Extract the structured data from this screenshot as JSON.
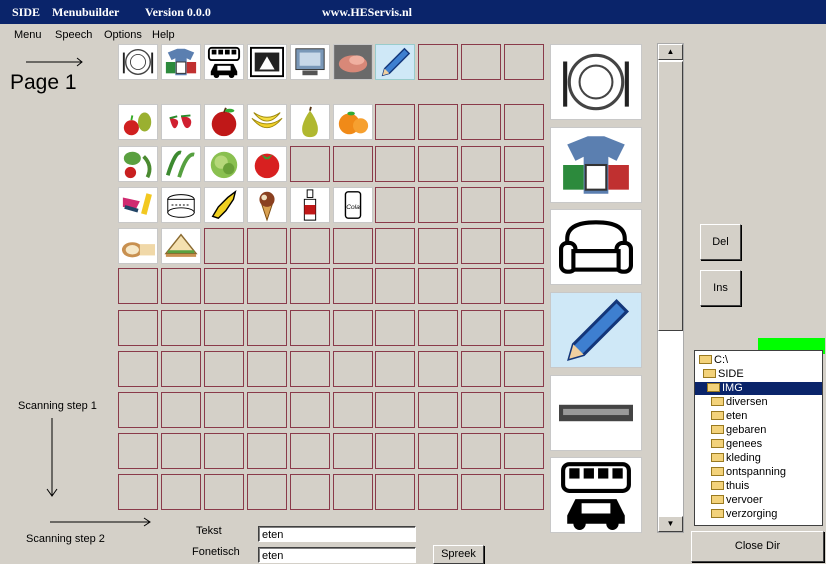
{
  "title": {
    "app": "SIDE",
    "name": "Menubuilder",
    "version": "Version 0.0.0",
    "website": "www.HEServis.nl"
  },
  "menu": [
    "Menu",
    "Speech",
    "Options",
    "Help"
  ],
  "page_label": "Page 1",
  "scan_step_1": "Scanning step 1",
  "scan_step_2": "Scanning step 2",
  "grid_rows": [
    [
      "plate-icon",
      "clothes-icon",
      "bus-car-icon",
      "laundry-icon",
      "computer-icon",
      "flesh-icon",
      "pencil-icon",
      "",
      "",
      ""
    ],
    [
      "apple-pear-icon",
      "strawberry-icon",
      "apple-icon",
      "banana-icon",
      "pear-icon",
      "orange-icon",
      "",
      "",
      "",
      ""
    ],
    [
      "vegetables-icon",
      "beans-icon",
      "lettuce-icon",
      "tomato-icon",
      "",
      "",
      "",
      "",
      "",
      ""
    ],
    [
      "candy-icon",
      "cake-icon",
      "sweet-icon",
      "icecream-icon",
      "bottle-icon",
      "can-icon",
      "",
      "",
      "",
      ""
    ],
    [
      "bread-icon",
      "sandwich-icon",
      "",
      "",
      "",
      "",
      "",
      "",
      "",
      ""
    ],
    [
      "",
      "",
      "",
      "",
      "",
      "",
      "",
      "",
      "",
      ""
    ],
    [
      "",
      "",
      "",
      "",
      "",
      "",
      "",
      "",
      "",
      ""
    ],
    [
      "",
      "",
      "",
      "",
      "",
      "",
      "",
      "",
      "",
      ""
    ],
    [
      "",
      "",
      "",
      "",
      "",
      "",
      "",
      "",
      "",
      ""
    ],
    [
      "",
      "",
      "",
      "",
      "",
      "",
      "",
      "",
      "",
      ""
    ],
    [
      "",
      "",
      "",
      "",
      "",
      "",
      "",
      "",
      "",
      ""
    ]
  ],
  "preview_icons": [
    "plate-icon",
    "clothes-icon",
    "sofa-icon",
    "pencil-icon",
    "keyboard-icon",
    "bus-car-icon"
  ],
  "buttons": {
    "del": "Del",
    "ins": "Ins",
    "close_dir": "Close Dir",
    "spreek": "Spreek"
  },
  "dirs": [
    {
      "label": "C:\\",
      "level": 0,
      "selected": false
    },
    {
      "label": "SIDE",
      "level": 1,
      "selected": false
    },
    {
      "label": "IMG",
      "level": 2,
      "selected": true
    },
    {
      "label": "diversen",
      "level": 3,
      "selected": false
    },
    {
      "label": "eten",
      "level": 3,
      "selected": false
    },
    {
      "label": "gebaren",
      "level": 3,
      "selected": false
    },
    {
      "label": "genees",
      "level": 3,
      "selected": false
    },
    {
      "label": "kleding",
      "level": 3,
      "selected": false
    },
    {
      "label": "ontspanning",
      "level": 3,
      "selected": false
    },
    {
      "label": "thuis",
      "level": 3,
      "selected": false
    },
    {
      "label": "vervoer",
      "level": 3,
      "selected": false
    },
    {
      "label": "verzorging",
      "level": 3,
      "selected": false
    }
  ],
  "fields": {
    "tekst_label": "Tekst",
    "tekst_value": "eten",
    "fonetisch_label": "Fonetisch",
    "fonetisch_value": "eten"
  },
  "colors": {
    "titlebar": "#0a246a",
    "cell_border": "#8a3a4a",
    "status": "#00ff00",
    "highlight": "#cfe8f7"
  }
}
